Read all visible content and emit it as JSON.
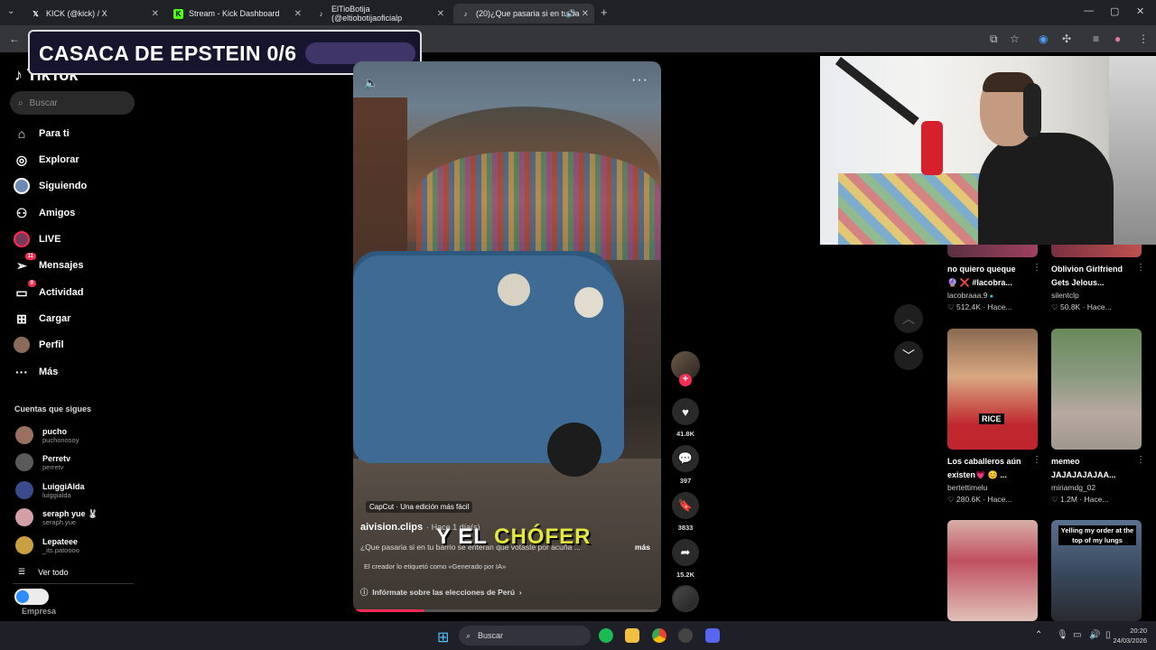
{
  "browser": {
    "tabs": [
      {
        "label": "KICK (@kick) / X",
        "icon": "x-icon"
      },
      {
        "label": "Stream - Kick Dashboard",
        "icon": "kick-icon"
      },
      {
        "label": "ElTioBotija (@eltiobotijaoficialp",
        "icon": "tiktok-icon"
      },
      {
        "label": "(20)¿Que pasaria si en tu ba",
        "icon": "tiktok-icon"
      }
    ],
    "new_tab": "+"
  },
  "banner": {
    "text": "CASACA DE EPSTEIN 0/6",
    "progress_fraction": 0
  },
  "sidebar": {
    "logo": "TikTok",
    "search_placeholder": "Buscar",
    "nav": [
      {
        "label": "Para ti",
        "icon": "home-icon"
      },
      {
        "label": "Explorar",
        "icon": "compass-icon"
      },
      {
        "label": "Siguiendo",
        "icon": "following-icon"
      },
      {
        "label": "Amigos",
        "icon": "friends-icon"
      },
      {
        "label": "LIVE",
        "icon": "live-icon"
      },
      {
        "label": "Mensajes",
        "icon": "messages-icon",
        "badge": "11"
      },
      {
        "label": "Actividad",
        "icon": "activity-icon",
        "badge": "9"
      },
      {
        "label": "Cargar",
        "icon": "upload-icon"
      },
      {
        "label": "Perfil",
        "icon": "profile-icon"
      },
      {
        "label": "Más",
        "icon": "more-icon"
      }
    ],
    "following_title": "Cuentas que sigues",
    "accounts": [
      {
        "name": "pucho",
        "handle": "puchonosoy"
      },
      {
        "name": "Perretv",
        "handle": "perretv"
      },
      {
        "name": "LuiggiAlda",
        "handle": "luiggialda"
      },
      {
        "name": "seraph yue 🐰",
        "handle": "seraph.yue"
      },
      {
        "name": "Lepateee",
        "handle": "_its.patoooo"
      }
    ],
    "see_all": "Ver todo",
    "footer": "Empresa"
  },
  "video": {
    "capcut": "CapCut · Una edición más fácil",
    "author": "aivision.clips",
    "time": "· Hace 1 día(s)",
    "overlay_text_a": "Y EL ",
    "overlay_text_b": "CHÓFER",
    "description": "¿Que pasaria si  en tu barrio  se enteran que votaste por  acuña ...",
    "more": "más",
    "ai_label": "El creador lo etiquetó como «Generado por IA»",
    "info_link": "Infórmate sobre las elecciones de Perú",
    "progress_fraction": 0.23
  },
  "actions": {
    "likes": "41.8K",
    "comments": "397",
    "saves": "3833",
    "shares": "15.2K"
  },
  "feed": [
    {
      "title1": "no quiero queque",
      "title2": "🔮 ❌ #lacobra...",
      "user": "lacobraaa.9",
      "verified": "●",
      "likes": "512.4K",
      "time": "· Hace..."
    },
    {
      "title1": "Oblivion Girlfriend",
      "title2": "Gets Jelous...",
      "user": "silentclp",
      "likes": "50.8K",
      "time": "· Hace..."
    },
    {
      "title1": "Los caballeros aún",
      "title2": "existen💗 😊 ...",
      "user": "bertettimelu",
      "likes": "280.6K",
      "time": "· Hace...",
      "thumb_label": "RICE"
    },
    {
      "title1": "memeo",
      "title2": "JAJAJAJAJAA...",
      "user": "miriamdg_02",
      "likes": "1.2M",
      "time": "· Hace..."
    },
    {
      "thumb_top": "Yelling my order at the top of my lungs"
    }
  ],
  "taskbar": {
    "search": "Buscar",
    "time": "20:20",
    "date": "24/03/2026"
  },
  "colors": {
    "accent": "#fe2c55",
    "banner_bg": "#17142e",
    "taskbar": "#1f1f28"
  }
}
